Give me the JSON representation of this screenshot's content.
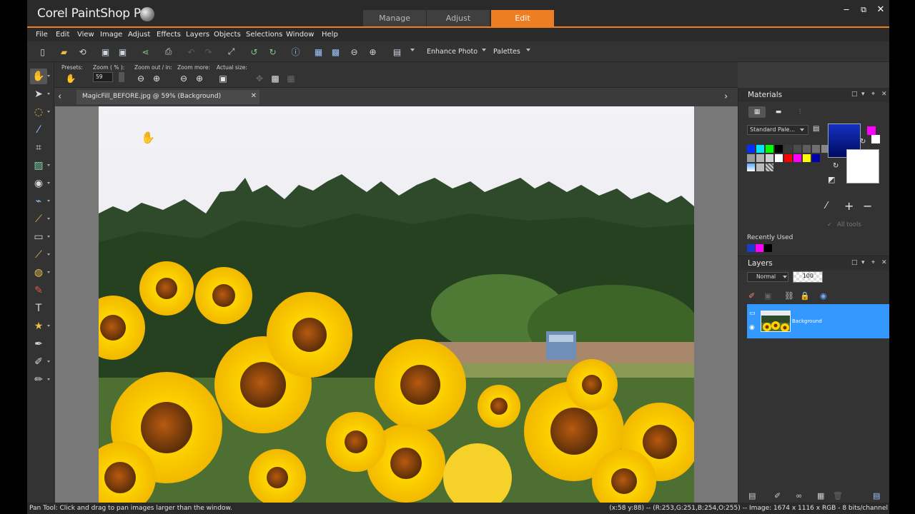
{
  "app": {
    "title": "Corel PaintShop Pro",
    "workspace_tabs": [
      {
        "label": "Manage",
        "active": false
      },
      {
        "label": "Adjust",
        "active": false
      },
      {
        "label": "Edit",
        "active": true
      }
    ],
    "window_controls": {
      "minimize": "‒",
      "maximize": "⧉",
      "close": "✕"
    },
    "accent_color": "#ef7d22"
  },
  "menu": [
    "File",
    "Edit",
    "View",
    "Image",
    "Adjust",
    "Effects",
    "Layers",
    "Objects",
    "Selections",
    "Window",
    "Help"
  ],
  "toolbar": {
    "enhance_photo": "Enhance Photo",
    "palettes": "Palettes"
  },
  "tool_options": {
    "presets_label": "Presets:",
    "zoom_label": "Zoom ( % ):",
    "zoom_value": "59",
    "zoom_out_in_label": "Zoom out / in:",
    "zoom_more_label": "Zoom more:",
    "actual_size_label": "Actual size:"
  },
  "document": {
    "tab_label": "MagicFill_BEFORE.jpg @  59% (Background)"
  },
  "materials": {
    "title": "Materials",
    "palette_select": "Standard Pale...",
    "all_tools": "All tools",
    "recently_used": "Recently Used",
    "swatch_rows": [
      [
        "#0030ff",
        "#00e5ff",
        "#00ff00",
        "#000000",
        "#3a3a3a",
        "#4b4b4b",
        "#5e5e5e",
        "#6f6f6f",
        "#888888"
      ],
      [
        "#9a9a9a",
        "#b5b5b5",
        "#d0d0d0",
        "#ffffff",
        "#ff0000",
        "#ff00ff",
        "#ffff00",
        "#0000aa"
      ]
    ],
    "recent_swatches": [
      "#1a3ccc",
      "#ff00ff",
      "#000000"
    ],
    "foreground_color": "#1530c0",
    "background_color": "#ffffff"
  },
  "layers": {
    "title": "Layers",
    "blend_mode": "Normal",
    "opacity": "100",
    "items": [
      {
        "name": "Background",
        "selected": true
      }
    ]
  },
  "status": {
    "left": "Pan Tool: Click and drag to pan images larger than the window.",
    "right": "(x:58 y:88) -- (R:253,G:251,B:254,O:255) -- Image:  1674 x 1116 x RGB - 8 bits/channel"
  }
}
